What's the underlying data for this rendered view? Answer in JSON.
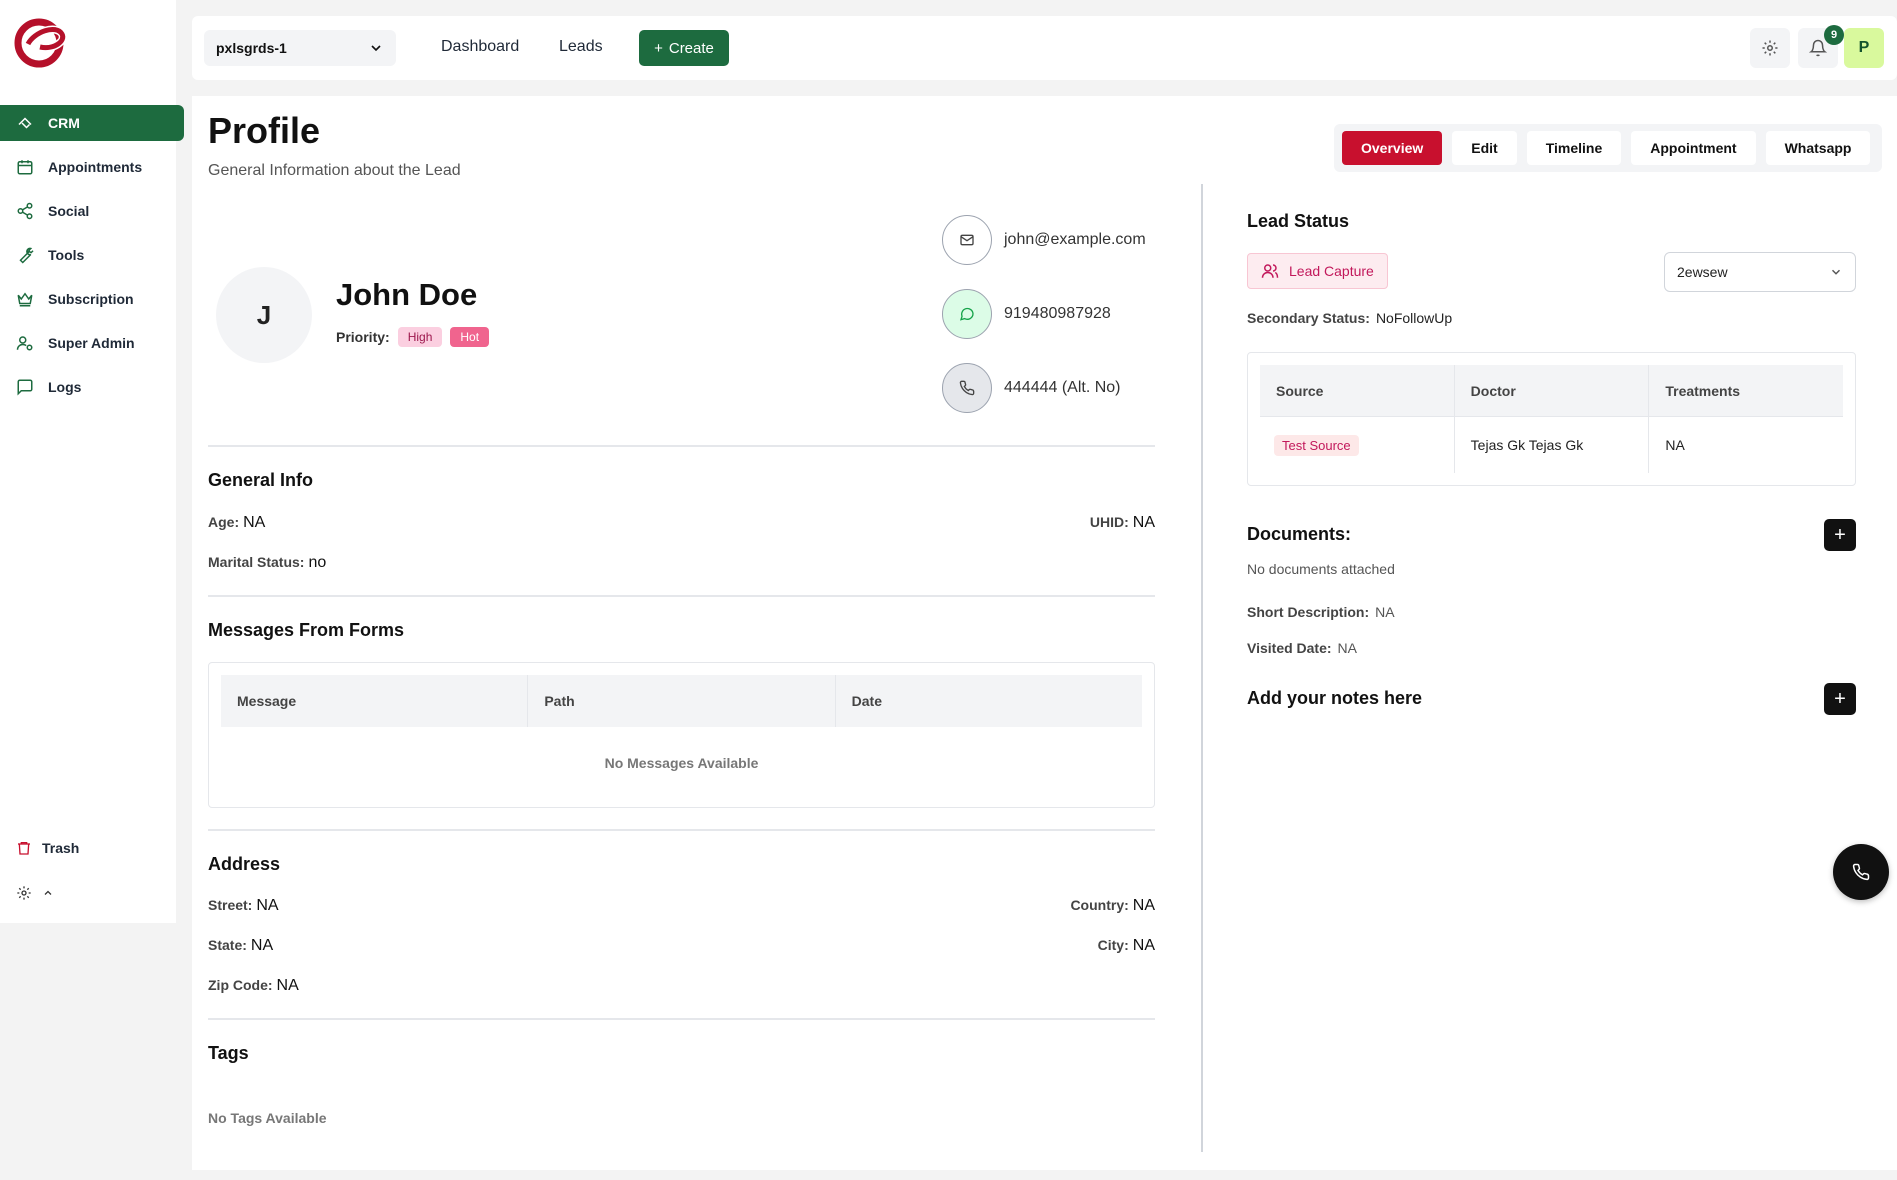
{
  "sidebar": {
    "items": [
      {
        "label": "CRM",
        "icon": "crm-icon",
        "active": true
      },
      {
        "label": "Appointments",
        "icon": "calendar-icon"
      },
      {
        "label": "Social",
        "icon": "share-icon"
      },
      {
        "label": "Tools",
        "icon": "wrench-icon"
      },
      {
        "label": "Subscription",
        "icon": "crown-icon"
      },
      {
        "label": "Super Admin",
        "icon": "user-cog-icon"
      },
      {
        "label": "Logs",
        "icon": "message-square-icon"
      }
    ],
    "trash_label": "Trash"
  },
  "topbar": {
    "org_value": "pxlsgrds-1",
    "nav": [
      "Dashboard",
      "Leads"
    ],
    "create_label": "Create",
    "notification_count": "9",
    "avatar_initial": "P"
  },
  "page": {
    "title": "Profile",
    "subtitle": "General Information about the Lead",
    "tabs": [
      "Overview",
      "Edit",
      "Timeline",
      "Appointment",
      "Whatsapp"
    ],
    "active_tab": "Overview"
  },
  "lead": {
    "initial": "J",
    "name": "John Doe",
    "priority_label": "Priority:",
    "priority_tags": [
      "High",
      "Hot"
    ],
    "email": "john@example.com",
    "whatsapp": "919480987928",
    "alt_phone": "444444 (Alt. No)"
  },
  "general_info": {
    "title": "General Info",
    "age_label": "Age:",
    "age": "NA",
    "uhid_label": "UHID:",
    "uhid": "NA",
    "marital_label": "Marital Status:",
    "marital": "no"
  },
  "messages": {
    "title": "Messages From Forms",
    "columns": [
      "Message",
      "Path",
      "Date"
    ],
    "empty": "No Messages Available"
  },
  "address": {
    "title": "Address",
    "street_label": "Street:",
    "street": "NA",
    "country_label": "Country:",
    "country": "NA",
    "state_label": "State:",
    "state": "NA",
    "city_label": "City:",
    "city": "NA",
    "zip_label": "Zip Code:",
    "zip": "NA"
  },
  "tags": {
    "title": "Tags",
    "empty": "No Tags Available"
  },
  "lead_status": {
    "title": "Lead Status",
    "status": "Lead Capture",
    "select_value": "2ewsew",
    "secondary_label": "Secondary Status:",
    "secondary_value": "NoFollowUp",
    "table_columns": [
      "Source",
      "Doctor",
      "Treatments"
    ],
    "table_row": {
      "source": "Test Source",
      "doctor": "Tejas Gk Tejas Gk",
      "treatments": "NA"
    }
  },
  "documents": {
    "title": "Documents:",
    "empty": "No documents attached",
    "short_desc_label": "Short Description:",
    "short_desc": "NA",
    "visited_label": "Visited Date:",
    "visited": "NA"
  },
  "notes": {
    "title": "Add your notes here"
  },
  "colors": {
    "brand_green": "#1d6b3f",
    "brand_red": "#c8102e"
  }
}
